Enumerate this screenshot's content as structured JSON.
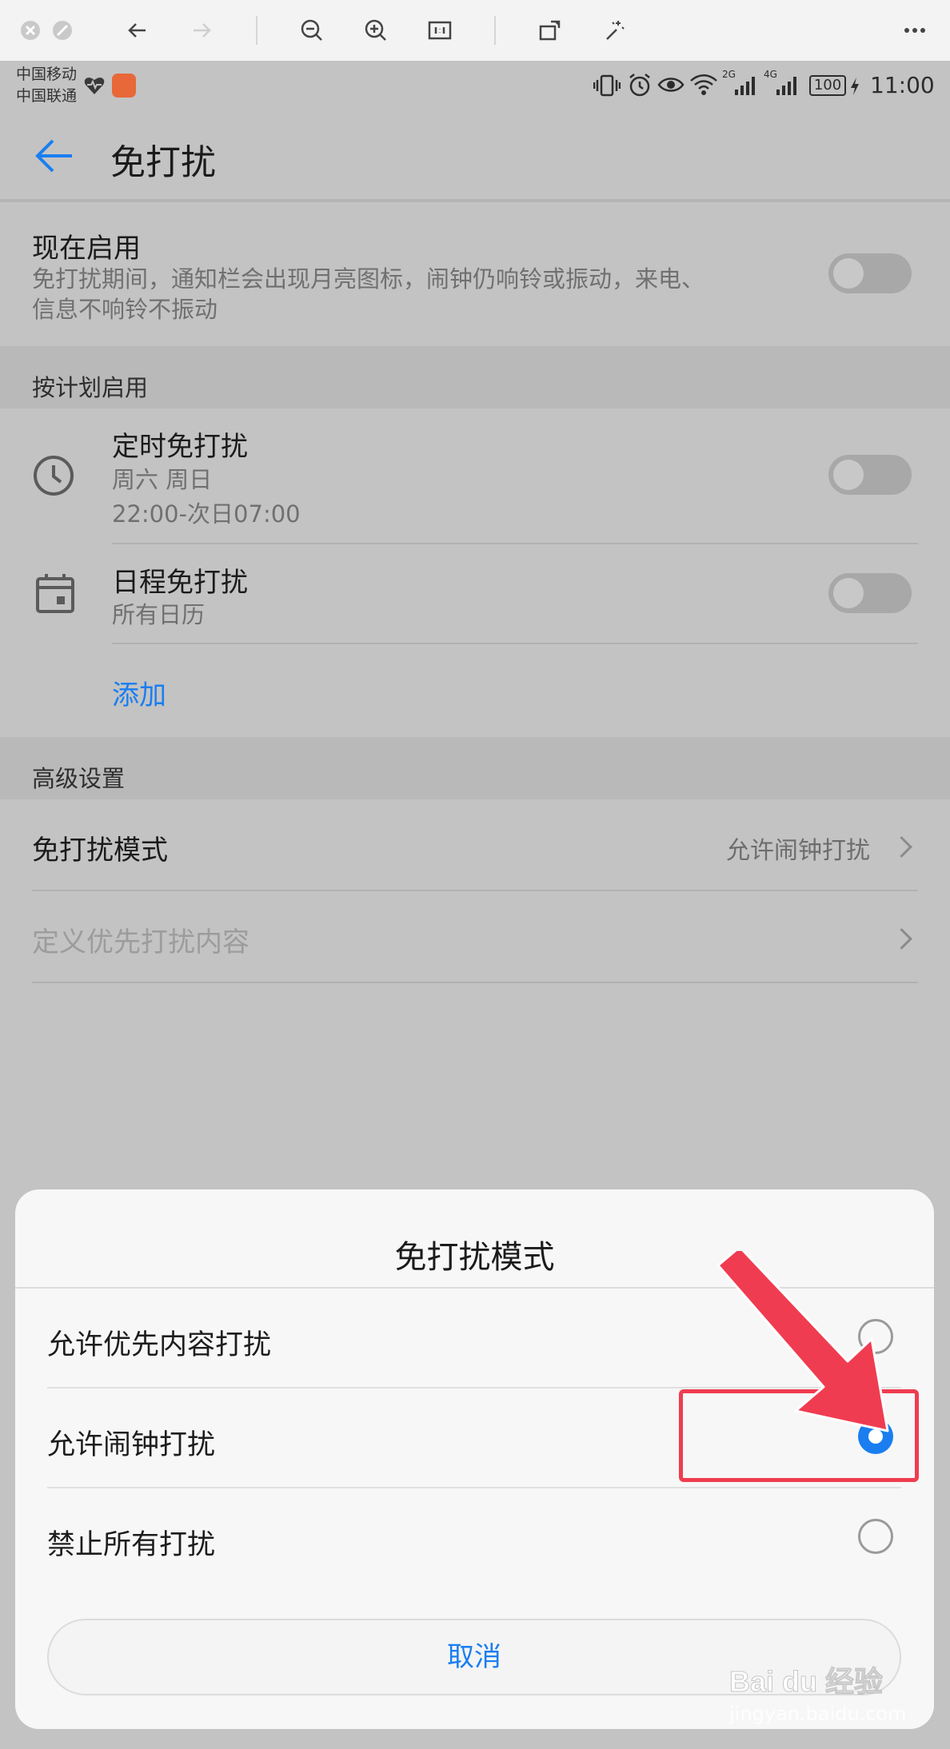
{
  "status": {
    "carrier1": "中国移动",
    "carrier2": "中国联通",
    "net1": "2G",
    "net2": "4G",
    "battery": "100",
    "time": "11:00"
  },
  "header": {
    "title": "免打扰"
  },
  "now_enable": {
    "title": "现在启用",
    "desc_line1": "免打扰期间，通知栏会出现月亮图标，闹钟仍响铃或振动，来电、",
    "desc_line2": "信息不响铃不振动",
    "enabled": false
  },
  "schedule": {
    "section_label": "按计划启用",
    "items": [
      {
        "title": "定时免打扰",
        "sub1": "周六 周日",
        "sub2": "22:00-次日07:00",
        "enabled": false
      },
      {
        "title": "日程免打扰",
        "sub1": "所有日历",
        "enabled": false
      }
    ],
    "add_label": "添加"
  },
  "advanced": {
    "section_label": "高级设置",
    "mode_label": "免打扰模式",
    "mode_value": "允许闹钟打扰",
    "priority_label": "定义优先打扰内容"
  },
  "dialog": {
    "title": "免打扰模式",
    "options": [
      {
        "label": "允许优先内容打扰",
        "selected": false
      },
      {
        "label": "允许闹钟打扰",
        "selected": true
      },
      {
        "label": "禁止所有打扰",
        "selected": false
      }
    ],
    "cancel_label": "取消"
  },
  "colors": {
    "accent": "#1a7ef0",
    "annotation_red": "#f03c50"
  },
  "watermark": {
    "brand": "Baidu经验",
    "url": "jingyan.baidu.com"
  }
}
